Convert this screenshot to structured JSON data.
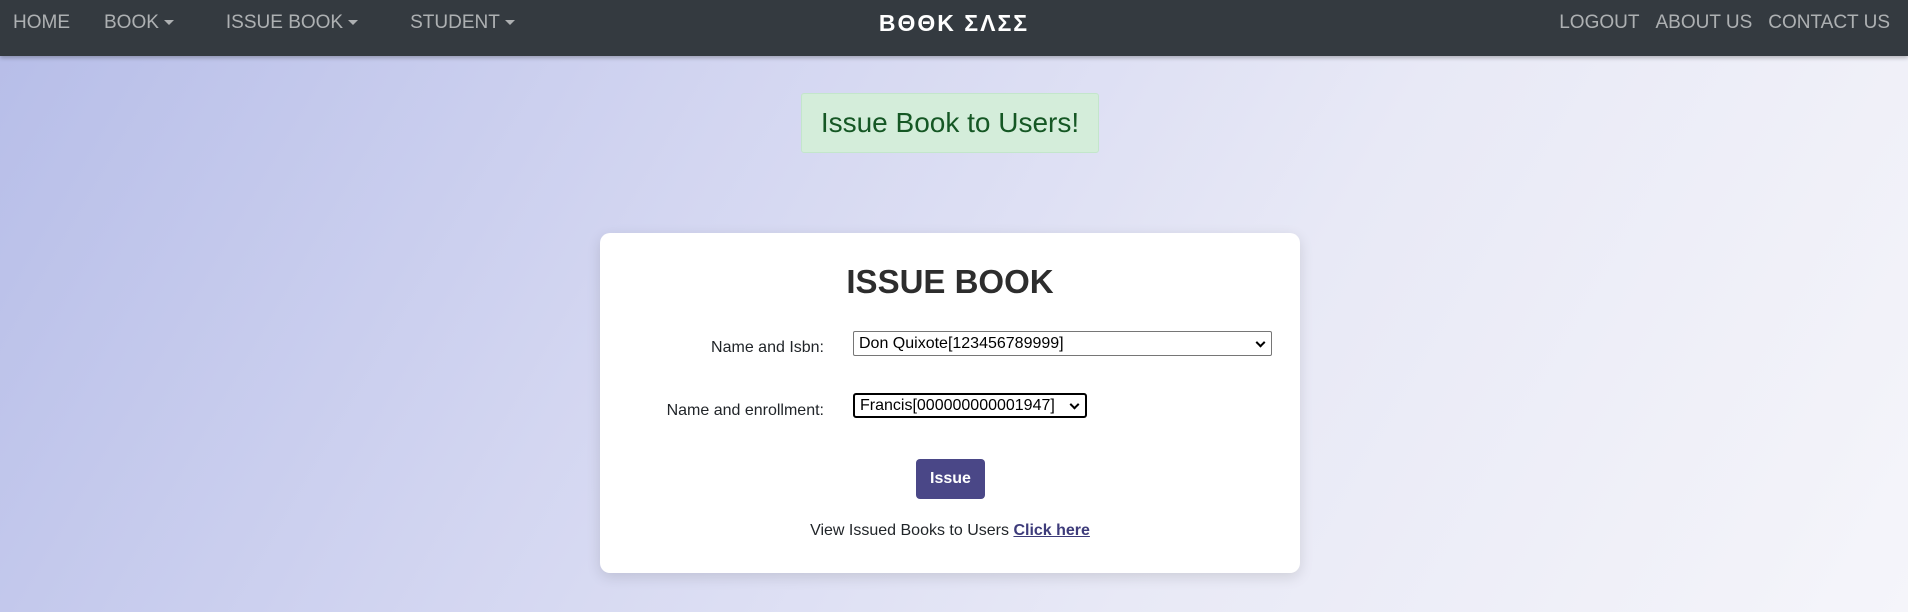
{
  "navbar": {
    "left": [
      {
        "label": "HOME",
        "dropdown": false
      },
      {
        "label": "BOOK",
        "dropdown": true
      },
      {
        "label": "ISSUE BOOK",
        "dropdown": true
      },
      {
        "label": "STUDENT",
        "dropdown": true
      }
    ],
    "brand": "ΒΘΘΚ ΣΛΣΣ",
    "right": [
      {
        "label": "LOGOUT"
      },
      {
        "label": "ABOUT US"
      },
      {
        "label": "CONTACT US"
      }
    ]
  },
  "alert": {
    "text": "Issue Book to Users!"
  },
  "form": {
    "title": "ISSUE BOOK",
    "book_label": "Name and Isbn:",
    "book_value": "Don Quixote[123456789999]",
    "student_label": "Name and enrollment:",
    "student_value": "Francis[000000000001947]",
    "submit_label": "Issue",
    "footer_text": "View Issued Books to Users",
    "footer_link": "Click here"
  },
  "colors": {
    "navbar_bg": "#343a40",
    "button_bg": "#4a4787",
    "alert_bg": "#d4edda",
    "alert_text": "#155724"
  }
}
